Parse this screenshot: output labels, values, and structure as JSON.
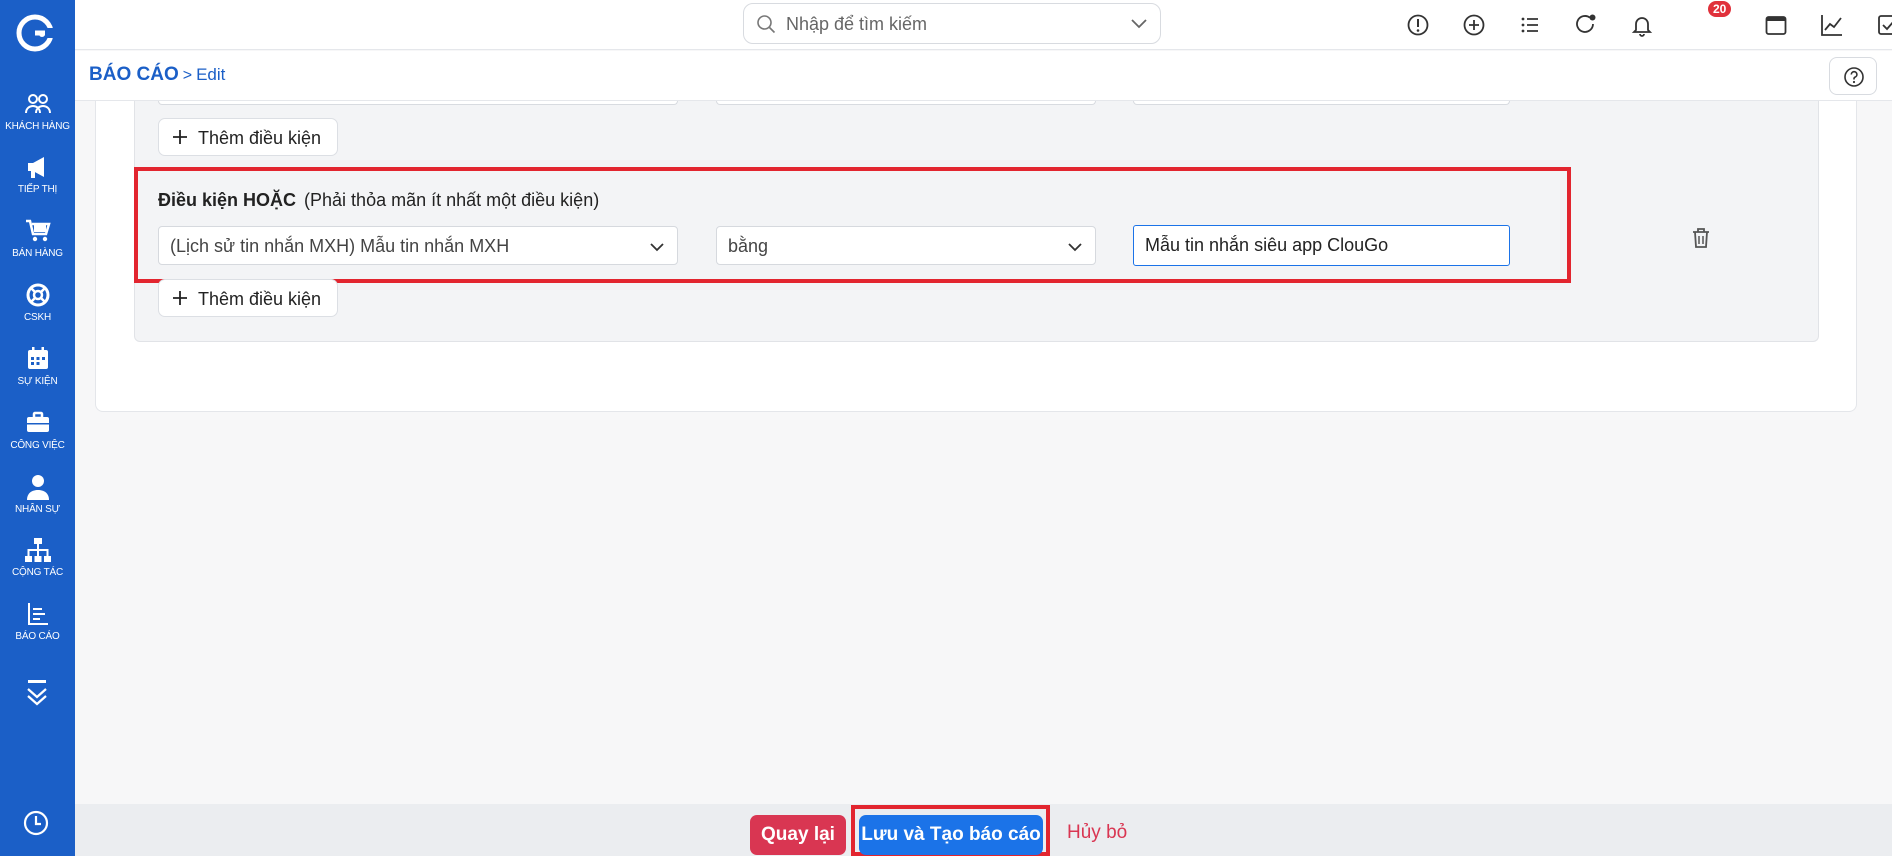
{
  "colors": {
    "sidebar": "#1b5fc7",
    "accent": "#1b73e8",
    "danger": "#d93652",
    "highlight_frame": "#e2252f",
    "badge": "#e0313b"
  },
  "sidebar": {
    "logo_icon": "cloudgo-logo-icon",
    "items": [
      {
        "label": "KHÁCH HÀNG",
        "icon": "customers-icon"
      },
      {
        "label": "TIẾP THỊ",
        "icon": "megaphone-icon"
      },
      {
        "label": "BÁN HÀNG",
        "icon": "cart-icon"
      },
      {
        "label": "CSKH",
        "icon": "lifebuoy-icon"
      },
      {
        "label": "SỰ KIỆN",
        "icon": "calendar-icon"
      },
      {
        "label": "CÔNG VIỆC",
        "icon": "briefcase-icon"
      },
      {
        "label": "NHÂN SỰ",
        "icon": "person-icon"
      },
      {
        "label": "CỘNG TÁC",
        "icon": "org-chart-icon"
      },
      {
        "label": "BÁO CÁO",
        "icon": "report-chart-icon"
      }
    ],
    "more_icon": "double-chevron-down-icon",
    "history_icon": "clock-icon"
  },
  "topbar": {
    "search_placeholder": "Nhập để tìm kiếm",
    "notification_count": "20",
    "icons": [
      "alert-icon",
      "plus-circle-icon",
      "list-icon",
      "refresh-icon",
      "bell-icon",
      "calendar-icon",
      "line-chart-icon",
      "checkbox-icon",
      "user-icon"
    ]
  },
  "header": {
    "breadcrumb_root": "BÁO CÁO",
    "breadcrumb_sep": ">",
    "breadcrumb_leaf": "Edit",
    "help_icon": "help-icon"
  },
  "conditions": {
    "add_condition_label": "Thêm điều kiện",
    "or_group": {
      "title": "Điều kiện HOẶC",
      "subtitle": "(Phải thỏa mãn ít nhất một điều kiện)",
      "field": "(Lịch sử tin nhắn MXH) Mẫu tin nhắn MXH",
      "operator": "bằng",
      "value": "Mẫu tin nhắn siêu app ClouGo"
    }
  },
  "footer": {
    "back_label": "Quay lại",
    "save_label": "Lưu và Tạo báo cáo",
    "cancel_label": "Hủy bỏ"
  }
}
